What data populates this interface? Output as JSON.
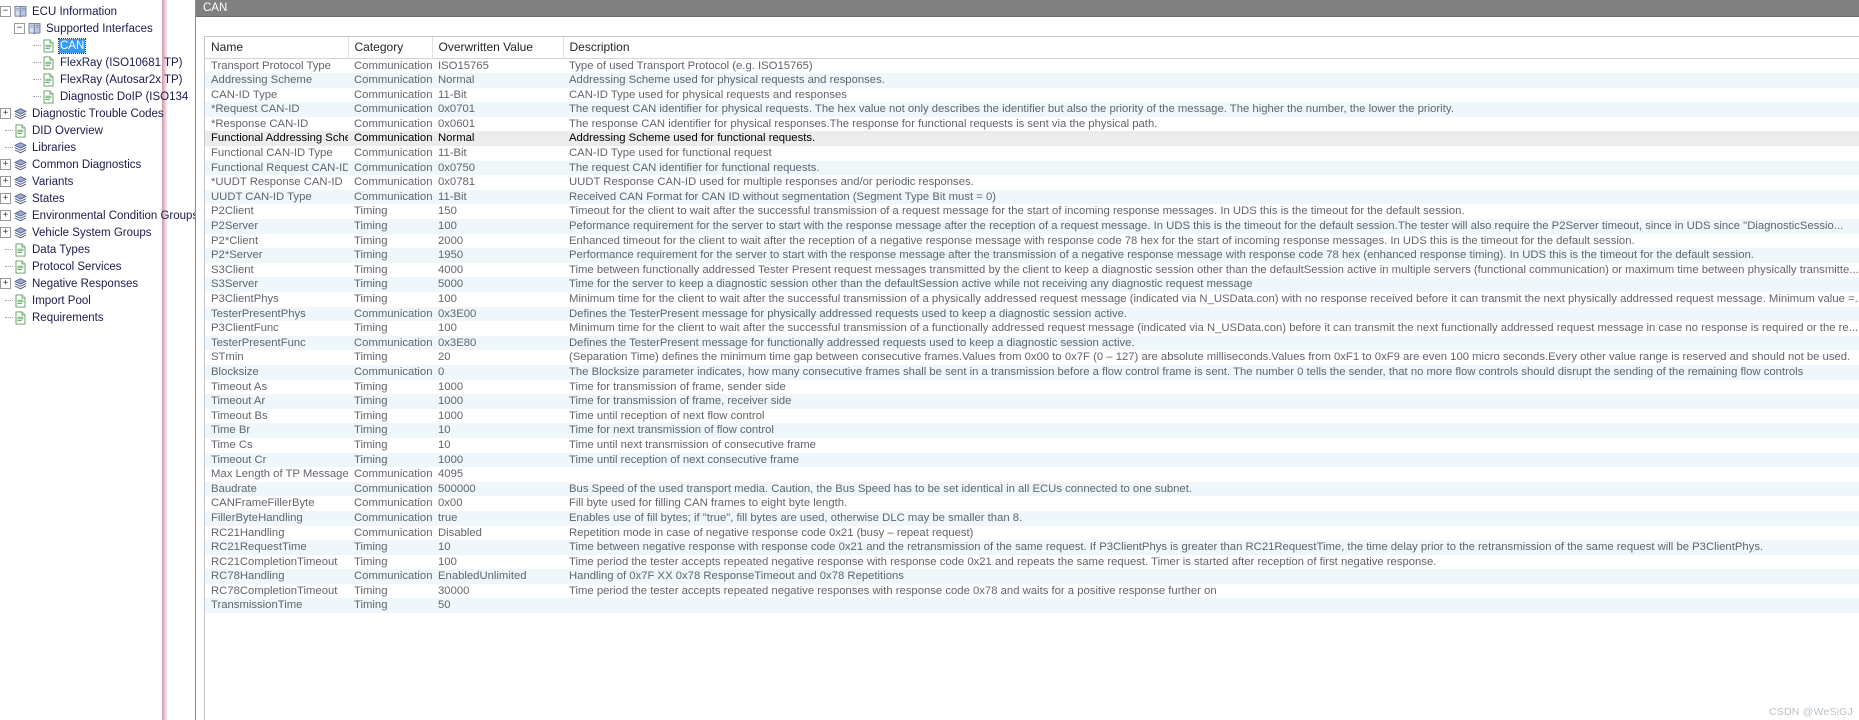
{
  "window": {
    "tab_label": "CAN",
    "watermark": "CSDN @WeSiGJ"
  },
  "colors": {
    "tab_bar_bg": "#808080",
    "selection_blue": "#3399ff",
    "row_alt": "#eff7fb",
    "row_selected": "#ececec",
    "text": "#60656e"
  },
  "tree": {
    "items": [
      {
        "label": "ECU Information",
        "depth": 0,
        "icon": "book-icon",
        "expander": "minus",
        "selected": false
      },
      {
        "label": "Supported Interfaces",
        "depth": 1,
        "icon": "book-icon",
        "expander": "minus",
        "selected": false
      },
      {
        "label": "CAN",
        "depth": 2,
        "icon": "doc-icon",
        "expander": "none",
        "selected": true
      },
      {
        "label": "FlexRay (ISO10681 TP)",
        "depth": 2,
        "icon": "doc-icon",
        "expander": "none",
        "selected": false
      },
      {
        "label": "FlexRay (Autosar2x TP)",
        "depth": 2,
        "icon": "doc-icon",
        "expander": "none",
        "selected": false
      },
      {
        "label": "Diagnostic DoIP (ISO134",
        "depth": 2,
        "icon": "doc-icon",
        "expander": "none",
        "selected": false
      },
      {
        "label": "Diagnostic Trouble Codes",
        "depth": 0,
        "icon": "stack-icon",
        "expander": "plus",
        "selected": false
      },
      {
        "label": "DID Overview",
        "depth": 0,
        "icon": "doc-icon",
        "expander": "none",
        "selected": false
      },
      {
        "label": "Libraries",
        "depth": 0,
        "icon": "stack-icon",
        "expander": "none",
        "selected": false
      },
      {
        "label": "Common Diagnostics",
        "depth": 0,
        "icon": "stack-icon",
        "expander": "plus",
        "selected": false
      },
      {
        "label": "Variants",
        "depth": 0,
        "icon": "stack-icon",
        "expander": "plus",
        "selected": false
      },
      {
        "label": "States",
        "depth": 0,
        "icon": "stack-icon",
        "expander": "plus",
        "selected": false
      },
      {
        "label": "Environmental Condition Groups",
        "depth": 0,
        "icon": "stack-icon",
        "expander": "plus",
        "selected": false
      },
      {
        "label": "Vehicle System Groups",
        "depth": 0,
        "icon": "stack-icon",
        "expander": "plus",
        "selected": false
      },
      {
        "label": "Data Types",
        "depth": 0,
        "icon": "doc-icon",
        "expander": "none",
        "selected": false
      },
      {
        "label": "Protocol Services",
        "depth": 0,
        "icon": "doc-icon",
        "expander": "none",
        "selected": false
      },
      {
        "label": "Negative Responses",
        "depth": 0,
        "icon": "stack-icon",
        "expander": "plus",
        "selected": false
      },
      {
        "label": "Import Pool",
        "depth": 0,
        "icon": "doc-icon",
        "expander": "none",
        "selected": false
      },
      {
        "label": "Requirements",
        "depth": 0,
        "icon": "doc-icon",
        "expander": "none",
        "selected": false
      }
    ]
  },
  "grid": {
    "columns": [
      "Name",
      "Category",
      "Overwritten Value",
      "Description"
    ],
    "selected_row_index": 5,
    "rows": [
      {
        "name": "Transport Protocol Type",
        "category": "Communication",
        "value": "ISO15765",
        "description": "Type of used Transport Protocol (e.g. ISO15765)"
      },
      {
        "name": "Addressing Scheme",
        "category": "Communication",
        "value": "Normal",
        "description": "Addressing Scheme used for physical requests and responses."
      },
      {
        "name": "CAN-ID Type",
        "category": "Communication",
        "value": "11-Bit",
        "description": "CAN-ID Type used for physical requests and responses"
      },
      {
        "name": "*Request CAN-ID",
        "category": "Communication",
        "value": "0x0701",
        "description": "The request CAN identifier for physical requests. The hex value not only describes the identifier but also the priority of the message. The higher the number, the lower the priority."
      },
      {
        "name": "*Response CAN-ID",
        "category": "Communication",
        "value": "0x0601",
        "description": "The response CAN identifier for physical responses.The response for functional requests is sent via the physical path."
      },
      {
        "name": "Functional Addressing Scheme",
        "category": "Communication",
        "value": "Normal",
        "description": "Addressing Scheme used for functional requests."
      },
      {
        "name": "Functional CAN-ID Type",
        "category": "Communication",
        "value": "11-Bit",
        "description": "CAN-ID Type used for functional request"
      },
      {
        "name": "Functional Request CAN-ID",
        "category": "Communication",
        "value": "0x0750",
        "description": "The request CAN identifier for functional requests."
      },
      {
        "name": "*UUDT Response CAN-ID",
        "category": "Communication",
        "value": "0x0781",
        "description": "UUDT Response CAN-ID used for multiple responses and/or periodic responses."
      },
      {
        "name": "UUDT CAN-ID Type",
        "category": "Communication",
        "value": "11-Bit",
        "description": "Received CAN Format for CAN ID without segmentation (Segment Type Bit must = 0)"
      },
      {
        "name": "P2Client",
        "category": "Timing",
        "value": "150",
        "description": "Timeout for the client to wait after the successful transmission of a request message for the start of incoming response messages. In UDS this is the timeout for the default session."
      },
      {
        "name": "P2Server",
        "category": "Timing",
        "value": "100",
        "description": "Peformance requirement for the server to start with the response message after the reception of a request message. In UDS this is the timeout for the default session.The tester will also require the P2Server timeout, since in UDS since \"DiagnosticSessio..."
      },
      {
        "name": "P2*Client",
        "category": "Timing",
        "value": "2000",
        "description": "Enhanced timeout for the client to wait after the reception of a negative response message with response code 78 hex for the start of incoming response messages. In UDS this is the timeout for the default session."
      },
      {
        "name": "P2*Server",
        "category": "Timing",
        "value": "1950",
        "description": "Performance requirement for the server to start with the response message after the transmission of a negative response message with response code 78 hex (enhanced response timing). In UDS this is the timeout for the default session."
      },
      {
        "name": "S3Client",
        "category": "Timing",
        "value": "4000",
        "description": "Time between functionally addressed Tester Present request messages transmitted by the client to keep a diagnostic session other than the defaultSession active in multiple servers (functional communication) or maximum time between physically transmitte..."
      },
      {
        "name": "S3Server",
        "category": "Timing",
        "value": "5000",
        "description": "Time for the server to keep a diagnostic session other than the defaultSession active while not receiving any diagnostic request message"
      },
      {
        "name": "P3ClientPhys",
        "category": "Timing",
        "value": "100",
        "description": "Minimum time for the client to wait after the successful transmission of a physically addressed request message (indicated via N_USData.con) with no response received before it can transmit the next physically addressed request message. Minimum value =..."
      },
      {
        "name": "TesterPresentPhys",
        "category": "Communication",
        "value": "0x3E00",
        "description": "Defines the TesterPresent message for physically addressed requests used to keep a diagnostic session active."
      },
      {
        "name": "P3ClientFunc",
        "category": "Timing",
        "value": "100",
        "description": "Minimum time for the client to wait after the successful transmission of a functionally addressed request message (indicated via N_USData.con) before it can transmit the next functionally addressed request message in case no response is required or the re..."
      },
      {
        "name": "TesterPresentFunc",
        "category": "Communication",
        "value": "0x3E80",
        "description": "Defines the TesterPresent message for functionally addressed requests used to keep a diagnostic session active."
      },
      {
        "name": "STmin",
        "category": "Timing",
        "value": "20",
        "description": "(Separation Time) defines the minimum time gap between consecutive frames.Values from 0x00 to 0x7F (0 – 127) are absolute milliseconds.Values from 0xF1 to 0xF9 are even 100 micro seconds.Every other value range is reserved and should not be used."
      },
      {
        "name": "Blocksize",
        "category": "Communication",
        "value": "0",
        "description": "The Blocksize parameter indicates, how many consecutive frames shall be sent in a transmission before a flow control frame is sent. The number 0 tells the sender, that no more flow controls should disrupt the sending of the remaining flow controls"
      },
      {
        "name": "Timeout As",
        "category": "Timing",
        "value": "1000",
        "description": "Time for transmission of frame, sender side"
      },
      {
        "name": "Timeout Ar",
        "category": "Timing",
        "value": "1000",
        "description": "Time for transmission of frame, receiver side"
      },
      {
        "name": "Timeout Bs",
        "category": "Timing",
        "value": "1000",
        "description": "Time until reception of next flow control"
      },
      {
        "name": "Time Br",
        "category": "Timing",
        "value": "10",
        "description": "Time for next transmission of flow control"
      },
      {
        "name": "Time Cs",
        "category": "Timing",
        "value": "10",
        "description": "Time until next transmission of consecutive frame"
      },
      {
        "name": "Timeout Cr",
        "category": "Timing",
        "value": "1000",
        "description": "Time until reception of next consecutive frame"
      },
      {
        "name": "Max Length of TP Message",
        "category": "Communication",
        "value": "4095",
        "description": ""
      },
      {
        "name": "Baudrate",
        "category": "Communication",
        "value": "500000",
        "description": "Bus Speed of the used transport media. Caution, the Bus Speed has to be set identical in all ECUs connected to one subnet."
      },
      {
        "name": "CANFrameFillerByte",
        "category": "Communication",
        "value": "0x00",
        "description": "Fill byte used for filling CAN frames to eight byte length."
      },
      {
        "name": "FillerByteHandling",
        "category": "Communication",
        "value": "true",
        "description": "Enables use of fill bytes; if \"true\", fill bytes are used, otherwise DLC may be smaller than 8."
      },
      {
        "name": "RC21Handling",
        "category": "Communication",
        "value": "Disabled",
        "description": "Repetition mode in case of negative response code 0x21 (busy – repeat request)"
      },
      {
        "name": "RC21RequestTime",
        "category": "Timing",
        "value": "10",
        "description": "Time between negative response with response code 0x21 and the retransmission of the same request. If P3ClientPhys is greater than RC21RequestTime, the time delay prior to the retransmission of the same request will be P3ClientPhys."
      },
      {
        "name": "RC21CompletionTimeout",
        "category": "Timing",
        "value": "100",
        "description": "Time period the tester accepts repeated negative response with response code 0x21 and repeats the same request. Timer is started after reception of first negative response."
      },
      {
        "name": "RC78Handling",
        "category": "Communication",
        "value": "EnabledUnlimited",
        "description": "Handling of 0x7F XX 0x78 ResponseTimeout and 0x78 Repetitions"
      },
      {
        "name": "RC78CompletionTimeout",
        "category": "Timing",
        "value": "30000",
        "description": "Time period the tester accepts repeated negative responses with response code 0x78 and waits for a positive response further on"
      },
      {
        "name": "TransmissionTime",
        "category": "Timing",
        "value": "50",
        "description": ""
      }
    ]
  }
}
